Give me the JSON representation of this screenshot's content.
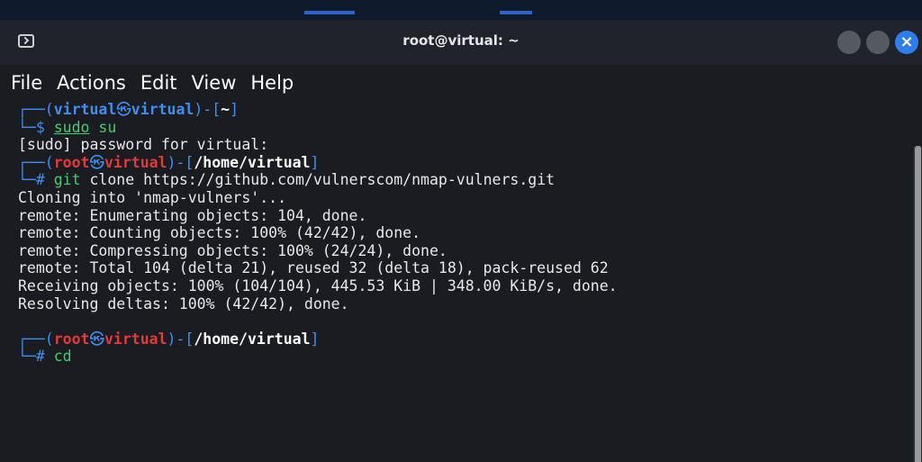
{
  "window": {
    "title": "root@virtual: ~",
    "close_glyph": "×"
  },
  "menu": [
    "File",
    "Actions",
    "Edit",
    "View",
    "Help"
  ],
  "prompt1": {
    "open": "┌──(",
    "user": "virtual",
    "at": "㉿",
    "host": "virtual",
    "mid": ")-[",
    "path": "~",
    "close": "]",
    "second": "└─$ ",
    "cmd": "sudo",
    "args": " su"
  },
  "sudo_line": "[sudo] password for virtual:",
  "prompt2": {
    "open": "┌──(",
    "user": "root",
    "at": "㉿",
    "host": "virtual",
    "mid": ")-[",
    "path": "/home/virtual",
    "close": "]",
    "second": "└─# ",
    "cmd": "git",
    "args": " clone https://github.com/vulnerscom/nmap-vulners.git"
  },
  "output": [
    "Cloning into 'nmap-vulners'...",
    "remote: Enumerating objects: 104, done.",
    "remote: Counting objects: 100% (42/42), done.",
    "remote: Compressing objects: 100% (24/24), done.",
    "remote: Total 104 (delta 21), reused 32 (delta 18), pack-reused 62",
    "Receiving objects: 100% (104/104), 445.53 KiB | 348.00 KiB/s, done.",
    "Resolving deltas: 100% (42/42), done."
  ],
  "prompt3": {
    "open": "┌──(",
    "user": "root",
    "at": "㉿",
    "host": "virtual",
    "mid": ")-[",
    "path": "/home/virtual",
    "close": "]",
    "second": "└─# ",
    "cmd": "cd",
    "args": ""
  },
  "colors": {
    "prompt_blue": "#3f8ff0",
    "root_red": "#e03a3a",
    "command_green": "#3bd16f",
    "close_button": "#2e7de9"
  }
}
